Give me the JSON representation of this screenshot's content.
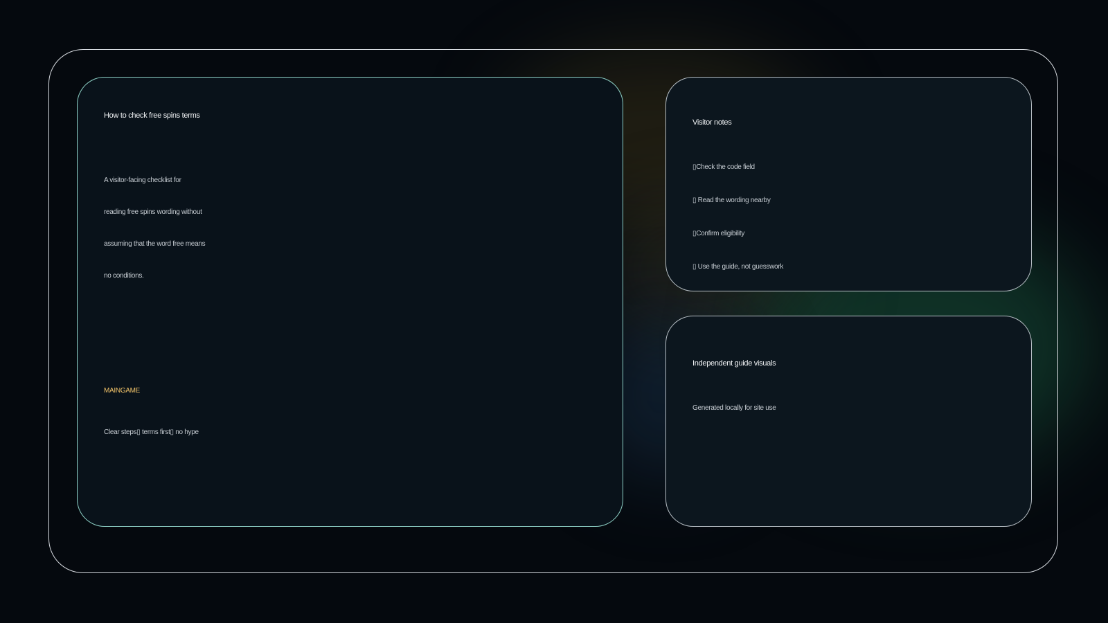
{
  "main_card": {
    "title": "How to check free spins terms",
    "body_lines": [
      "A visitor-facing checklist for",
      "reading free spins wording without",
      "assuming that the word free means",
      "no conditions."
    ],
    "brand": "MAINGAME",
    "tagline": "Clear steps▯ terms first▯ no hype"
  },
  "notes_card": {
    "title": "Visitor notes",
    "items": [
      "▯Check the code field",
      "▯ Read the wording nearby",
      "▯Confirm eligibility",
      "▯ Use the guide, not guesswork"
    ]
  },
  "visuals_card": {
    "title": "Independent guide visuals",
    "subtitle": "Generated locally for site use"
  },
  "colors": {
    "background": "#05090e",
    "main_card_border": "#8fd3c8",
    "side_card_border": "#b8c0c6",
    "brand": "#f3c56a"
  }
}
